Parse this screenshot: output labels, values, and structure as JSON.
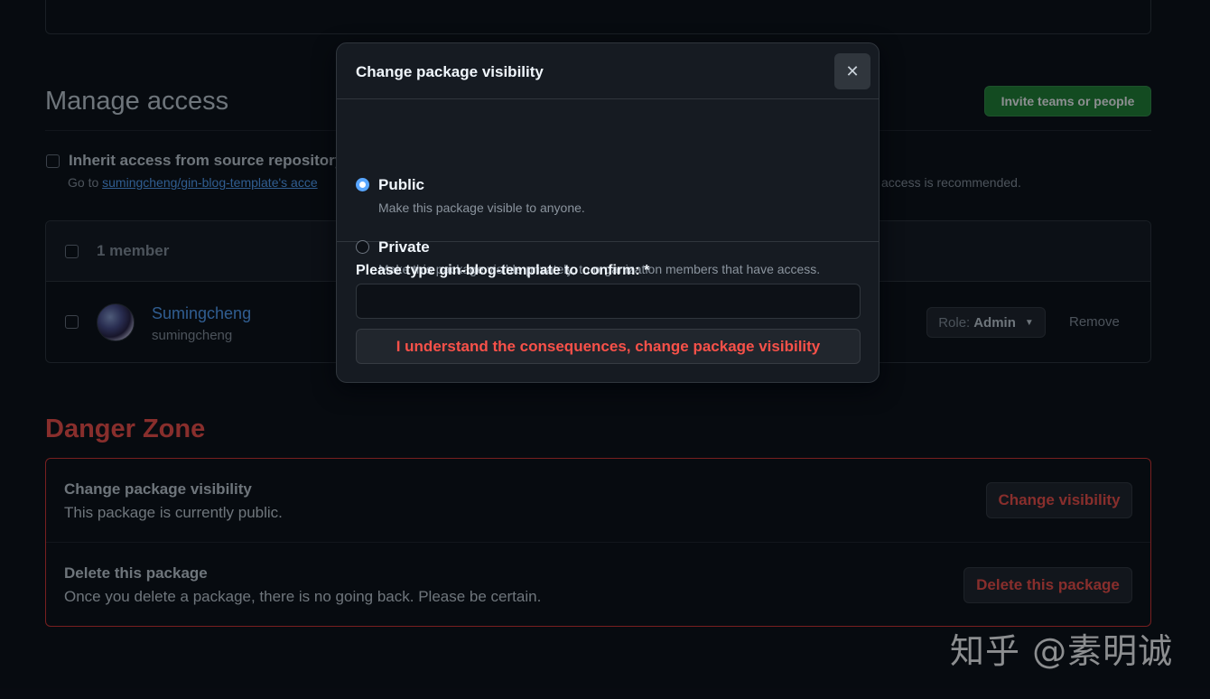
{
  "manage_access": {
    "title": "Manage access",
    "invite_button": "Invite teams or people",
    "inherit_label": "Inherit access from source repository",
    "inherit_note_prefix": "Go to ",
    "inherit_note_link": "sumingcheng/gin-blog-template's acce",
    "inherit_note_suffix": "access is recommended."
  },
  "members": {
    "count_label": "1 member",
    "rows": [
      {
        "name": "Sumingcheng",
        "login": "sumingcheng",
        "role_prefix": "Role:",
        "role": "Admin",
        "remove": "Remove"
      }
    ]
  },
  "danger_zone": {
    "title": "Danger Zone",
    "items": [
      {
        "title": "Change package visibility",
        "desc": "This package is currently public.",
        "button": "Change visibility"
      },
      {
        "title": "Delete this package",
        "desc": "Once you delete a package, there is no going back. Please be certain.",
        "button": "Delete this package"
      }
    ]
  },
  "modal": {
    "title": "Change package visibility",
    "close_icon": "x-icon",
    "options": [
      {
        "label": "Public",
        "desc": "Make this package visible to anyone.",
        "checked": true
      },
      {
        "label": "Private",
        "desc": "Make this package visible privately, to organization members that have access.",
        "checked": false
      }
    ],
    "confirm_label": "Please type gin-blog-template to confirm: *",
    "confirm_value": "",
    "confirm_button": "I understand the consequences, change package visibility"
  },
  "watermark": "知乎 @素明诚",
  "colors": {
    "accent": "#58a6ff",
    "danger": "#f85149",
    "primary": "#238636",
    "background": "#0d1117"
  }
}
